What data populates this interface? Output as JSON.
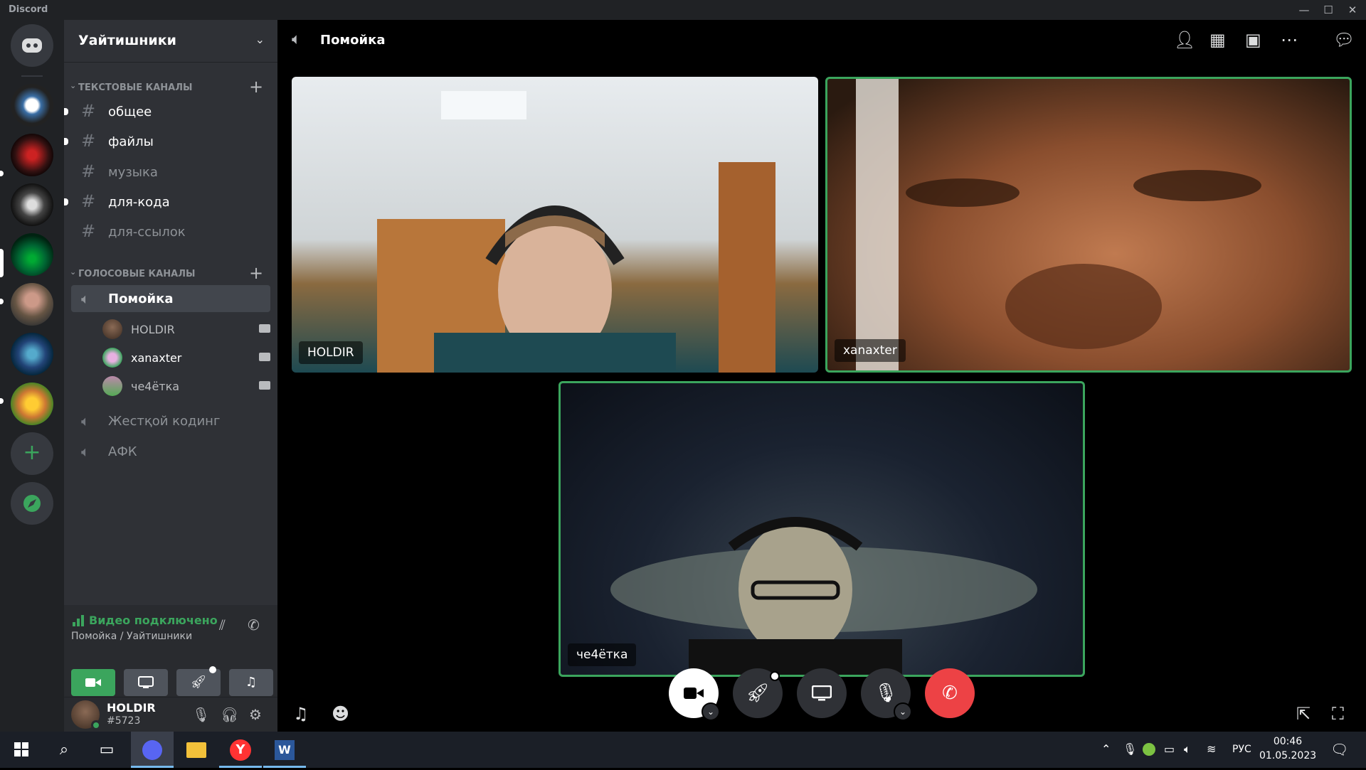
{
  "app": {
    "name": "Discord"
  },
  "window_controls": {
    "minimize": "—",
    "maximize": "☐",
    "close": "✕"
  },
  "guild": {
    "name": "Уайтишники"
  },
  "categories": {
    "text": "Текстовые каналы",
    "voice": "Голосовые каналы"
  },
  "text_channels": [
    "общее",
    "файлы",
    "музыка",
    "для-кода",
    "для-ссылок"
  ],
  "voice_channels": {
    "active": "Помойка",
    "users": [
      "HOLDIR",
      "xanaxter",
      "че4ётка"
    ],
    "others": [
      "Жестқой кодинг",
      "АФК"
    ]
  },
  "voice_status": {
    "title": "Видео подключено",
    "subtitle": "Помойка / Уайтишники"
  },
  "user": {
    "name": "HOLDIR",
    "tag": "#5723"
  },
  "header": {
    "channel": "Помойка"
  },
  "tiles": [
    "HOLDIR",
    "xanaxter",
    "че4ётка"
  ],
  "taskbar": {
    "lang": "РУС",
    "time": "00:46",
    "date": "01.05.2023"
  },
  "colors": {
    "accent_green": "#3ba55d",
    "danger_red": "#ed4245",
    "blurple": "#5865f2"
  }
}
